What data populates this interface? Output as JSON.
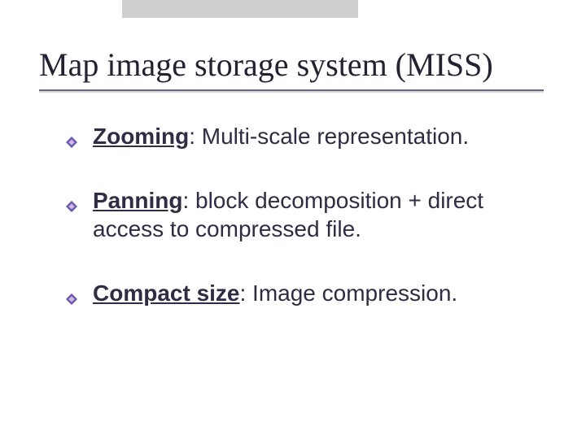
{
  "title": "Map image storage system (MISS)",
  "bullets": [
    {
      "label": "Zooming",
      "rest": ": Multi-scale representation."
    },
    {
      "label": "Panning",
      "rest": ": block decomposition + direct access to compressed file."
    },
    {
      "label": "Compact size",
      "rest": ": Image compression."
    }
  ],
  "colors": {
    "bullet_outer": "#6a5fae",
    "bullet_inner": "#d7b7e6"
  }
}
